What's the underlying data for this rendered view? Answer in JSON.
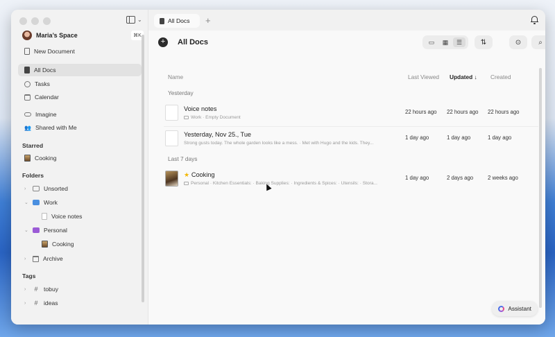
{
  "sidebar": {
    "space_name": "Maria’s Space",
    "space_button": "⌘K",
    "items": [
      {
        "label": "New Document"
      },
      {
        "label": "All Docs"
      },
      {
        "label": "Tasks"
      },
      {
        "label": "Calendar"
      },
      {
        "label": "Imagine"
      },
      {
        "label": "Shared with Me"
      }
    ],
    "starred_heading": "Starred",
    "starred": [
      {
        "label": "Cooking"
      }
    ],
    "folders_heading": "Folders",
    "folders": [
      {
        "label": "Unsorted"
      },
      {
        "label": "Work"
      },
      {
        "label": "Voice notes"
      },
      {
        "label": "Personal"
      },
      {
        "label": "Cooking"
      },
      {
        "label": "Archive"
      }
    ],
    "tags_heading": "Tags",
    "tags": [
      {
        "label": "tobuy"
      },
      {
        "label": "ideas"
      }
    ]
  },
  "tabbar": {
    "tab_label": "All Docs",
    "add_label": "+"
  },
  "main": {
    "title": "All Docs",
    "columns": {
      "name": "Name",
      "last_viewed": "Last Viewed",
      "updated": "Updated ↓",
      "created": "Created"
    },
    "groups": [
      {
        "label": "Yesterday",
        "rows": [
          {
            "title": "Voice notes",
            "meta": "Work · Empty Document",
            "last_viewed": "22 hours ago",
            "updated": "22 hours ago",
            "created": "22 hours ago"
          },
          {
            "title": "Yesterday, Nov 25., Tue",
            "meta": "Strong gusts today. The whole garden looks like a mess. · Met with Hugo and the kids. They...",
            "last_viewed": "1 day ago",
            "updated": "1 day ago",
            "created": "1 day ago"
          }
        ]
      },
      {
        "label": "Last 7 days",
        "rows": [
          {
            "title": "Cooking",
            "meta": "Personal · Kitchen Essentials: · Baking Supplies: · Ingredients & Spices: · Utensils: · Stora...",
            "last_viewed": "1 day ago",
            "updated": "2 days ago",
            "created": "2 weeks ago"
          }
        ]
      }
    ],
    "assistant_label": "Assistant"
  },
  "colors": {
    "accent_star": "#f2b705",
    "work_folder": "#4a8fe0",
    "personal_folder": "#9b5bd6"
  }
}
